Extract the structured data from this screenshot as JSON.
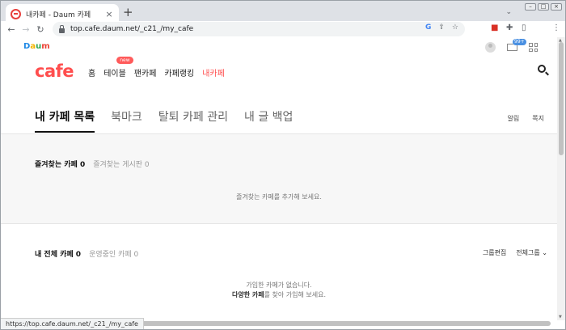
{
  "browser": {
    "tab_title": "내카페 - Daum 카페",
    "url": "top.cafe.daum.net/_c21_/my_cafe",
    "status_url": "https://top.cafe.daum.net/_c21_/my_cafe"
  },
  "header": {
    "daum_logo": "Daum",
    "cafe_logo": "cafe",
    "mail_badge": "99+",
    "gnb": [
      {
        "label": "홈"
      },
      {
        "label": "테이블",
        "badge": "new"
      },
      {
        "label": "팬카페"
      },
      {
        "label": "카페랭킹"
      },
      {
        "label": "내카페"
      }
    ]
  },
  "tabs": [
    "내 카페 목록",
    "북마크",
    "탈퇴 카페 관리",
    "내 글 백업"
  ],
  "side_links": [
    "알림",
    "쪽지"
  ],
  "favorites": {
    "title": "즐겨찾는 카페 0",
    "subtitle": "즐겨찾는 게시판 0",
    "empty": "즐겨찾는 카페를 추가해 보세요."
  },
  "all_cafes": {
    "title": "내 전체 카페 0",
    "subtitle": "운영중인 카페 0",
    "group_edit": "그룹편집",
    "group_select": "전체그룹",
    "empty_line1": "가입한 카페가 없습니다.",
    "empty_line2_bold": "다양한 카페",
    "empty_line2_rest": "를 찾아 가입해 보세요."
  },
  "colors": {
    "accent": "#ff4e4e"
  }
}
